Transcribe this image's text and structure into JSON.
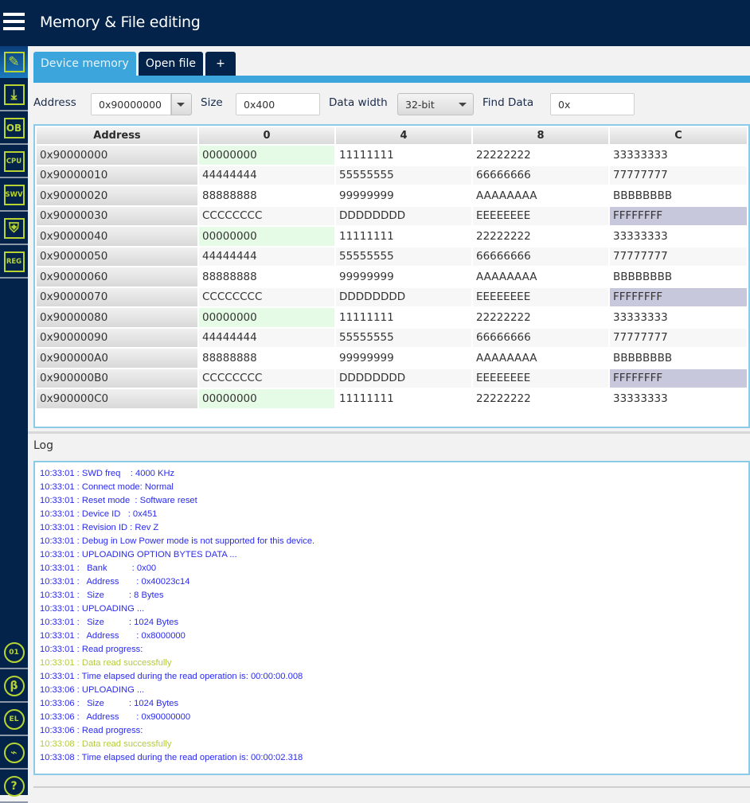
{
  "header": {
    "title": "Memory & File editing",
    "menu_icon": "hamburger-menu-icon"
  },
  "sidebar": {
    "items": [
      {
        "name": "memory-edit",
        "icon": "pencil-edit-icon",
        "glyph": "✎",
        "active": true
      },
      {
        "name": "download",
        "icon": "download-icon",
        "glyph": "⤓"
      },
      {
        "name": "option-bytes",
        "icon": "ob-icon",
        "glyph": "OB"
      },
      {
        "name": "cpu",
        "icon": "cpu-icon",
        "glyph": "CPU"
      },
      {
        "name": "swv",
        "icon": "swv-icon",
        "glyph": "SWV"
      },
      {
        "name": "security",
        "icon": "shield-icon",
        "glyph": "⛨"
      },
      {
        "name": "registers",
        "icon": "reg-icon",
        "glyph": "REG"
      }
    ],
    "bottom_items": [
      {
        "name": "binary",
        "icon": "binary-icon",
        "glyph": "01"
      },
      {
        "name": "beta",
        "icon": "beta-bug-icon",
        "glyph": "β"
      },
      {
        "name": "el",
        "icon": "el-icon",
        "glyph": "EL"
      },
      {
        "name": "plugin",
        "icon": "plug-icon",
        "glyph": "⌁"
      },
      {
        "name": "help",
        "icon": "help-icon",
        "glyph": "?"
      }
    ]
  },
  "tabs": [
    {
      "label": "Device memory",
      "active": true
    },
    {
      "label": "Open file"
    },
    {
      "label": "+"
    }
  ],
  "toolbar": {
    "address_label": "Address",
    "address_value": "0x90000000",
    "size_label": "Size",
    "size_value": "0x400",
    "data_width_label": "Data width",
    "data_width_value": "32-bit",
    "find_label": "Find Data",
    "find_value": "0x"
  },
  "memory_table": {
    "headers": [
      "Address",
      "0",
      "4",
      "8",
      "C"
    ],
    "rows": [
      {
        "address": "0x90000000",
        "values": [
          "00000000",
          "11111111",
          "22222222",
          "33333333"
        ]
      },
      {
        "address": "0x90000010",
        "values": [
          "44444444",
          "55555555",
          "66666666",
          "77777777"
        ]
      },
      {
        "address": "0x90000020",
        "values": [
          "88888888",
          "99999999",
          "AAAAAAAA",
          "BBBBBBBB"
        ]
      },
      {
        "address": "0x90000030",
        "values": [
          "CCCCCCCC",
          "DDDDDDDD",
          "EEEEEEEE",
          "FFFFFFFF"
        ]
      },
      {
        "address": "0x90000040",
        "values": [
          "00000000",
          "11111111",
          "22222222",
          "33333333"
        ]
      },
      {
        "address": "0x90000050",
        "values": [
          "44444444",
          "55555555",
          "66666666",
          "77777777"
        ]
      },
      {
        "address": "0x90000060",
        "values": [
          "88888888",
          "99999999",
          "AAAAAAAA",
          "BBBBBBBB"
        ]
      },
      {
        "address": "0x90000070",
        "values": [
          "CCCCCCCC",
          "DDDDDDDD",
          "EEEEEEEE",
          "FFFFFFFF"
        ]
      },
      {
        "address": "0x90000080",
        "values": [
          "00000000",
          "11111111",
          "22222222",
          "33333333"
        ]
      },
      {
        "address": "0x90000090",
        "values": [
          "44444444",
          "55555555",
          "66666666",
          "77777777"
        ]
      },
      {
        "address": "0x900000A0",
        "values": [
          "88888888",
          "99999999",
          "AAAAAAAA",
          "BBBBBBBB"
        ]
      },
      {
        "address": "0x900000B0",
        "values": [
          "CCCCCCCC",
          "DDDDDDDD",
          "EEEEEEEE",
          "FFFFFFFF"
        ]
      },
      {
        "address": "0x900000C0",
        "values": [
          "00000000",
          "11111111",
          "22222222",
          "33333333"
        ]
      }
    ],
    "highlight_colors": {
      "zero": "#e5fbe5",
      "ones": "#c8c8dc"
    }
  },
  "log": {
    "label": "Log",
    "colors": {
      "info": "#2a2aef",
      "success": "#b5c93d"
    },
    "lines": [
      {
        "text": "10:33:01 : SWD freq    : 4000 KHz",
        "type": "info"
      },
      {
        "text": "10:33:01 : Connect mode: Normal",
        "type": "info"
      },
      {
        "text": "10:33:01 : Reset mode  : Software reset",
        "type": "info"
      },
      {
        "text": "10:33:01 : Device ID   : 0x451",
        "type": "info"
      },
      {
        "text": "10:33:01 : Revision ID : Rev Z",
        "type": "info"
      },
      {
        "text": "10:33:01 : Debug in Low Power mode is not supported for this device.",
        "type": "info"
      },
      {
        "text": "10:33:01 : UPLOADING OPTION BYTES DATA ...",
        "type": "info"
      },
      {
        "text": "10:33:01 :   Bank          : 0x00",
        "type": "info"
      },
      {
        "text": "10:33:01 :   Address       : 0x40023c14",
        "type": "info"
      },
      {
        "text": "10:33:01 :   Size          : 8 Bytes",
        "type": "info"
      },
      {
        "text": "10:33:01 : UPLOADING ...",
        "type": "info"
      },
      {
        "text": "10:33:01 :   Size          : 1024 Bytes",
        "type": "info"
      },
      {
        "text": "10:33:01 :   Address       : 0x8000000",
        "type": "info"
      },
      {
        "text": "10:33:01 : Read progress:",
        "type": "info"
      },
      {
        "text": "10:33:01 : Data read successfully",
        "type": "success"
      },
      {
        "text": "10:33:01 : Time elapsed during the read operation is: 00:00:00.008",
        "type": "info"
      },
      {
        "text": "10:33:06 : UPLOADING ...",
        "type": "info"
      },
      {
        "text": "10:33:06 :   Size          : 1024 Bytes",
        "type": "info"
      },
      {
        "text": "10:33:06 :   Address       : 0x90000000",
        "type": "info"
      },
      {
        "text": "10:33:06 : Read progress:",
        "type": "info"
      },
      {
        "text": "10:33:08 : Data read successfully",
        "type": "success"
      },
      {
        "text": "10:33:08 : Time elapsed during the read operation is: 00:00:02.318",
        "type": "info"
      }
    ]
  }
}
